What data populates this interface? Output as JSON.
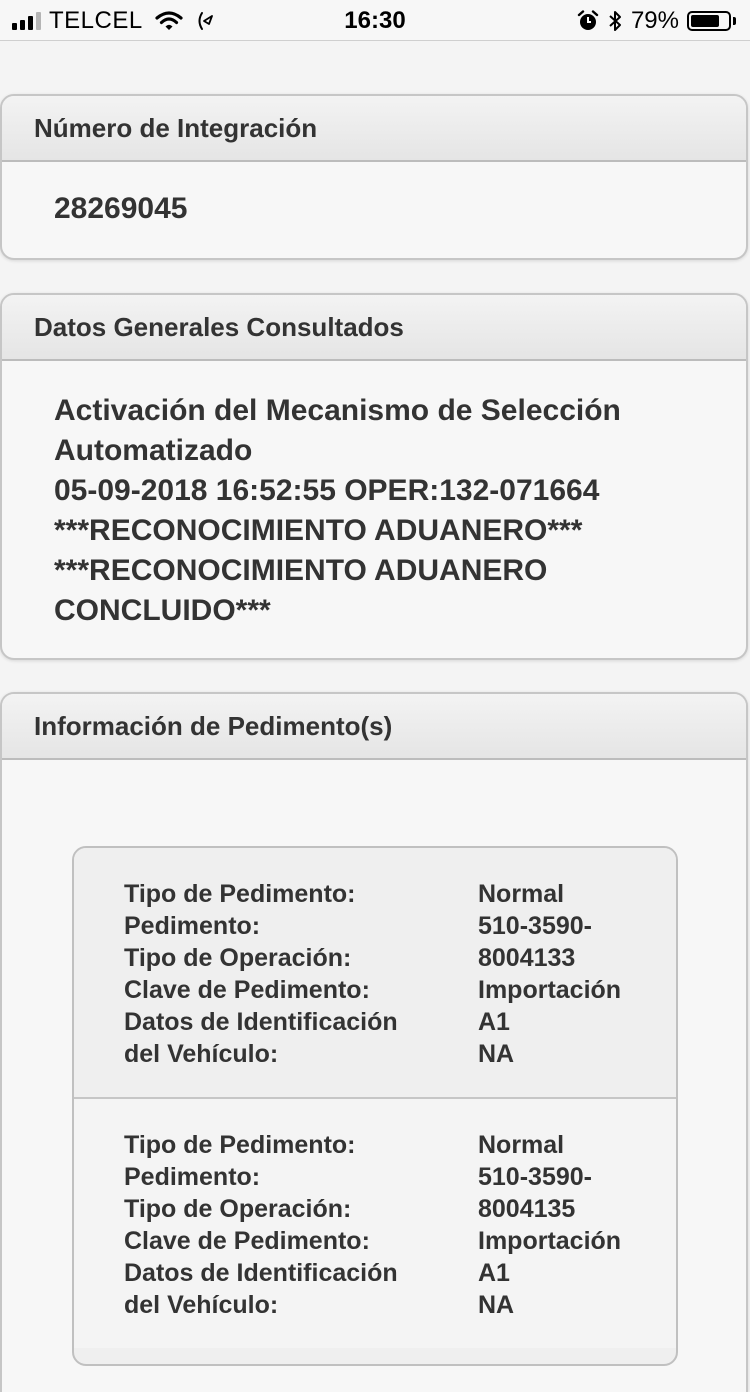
{
  "status_bar": {
    "carrier": "TELCEL",
    "time": "16:30",
    "battery_percent": "79%",
    "battery_level": 0.79,
    "icons": [
      "signal-icon",
      "wifi-icon",
      "location-icon",
      "alarm-icon",
      "bluetooth-icon",
      "battery-icon"
    ]
  },
  "integration": {
    "header": "Número de Integración",
    "number": "28269045"
  },
  "general_data": {
    "header": "Datos Generales Consultados",
    "lines": [
      "Activación del Mecanismo de Selección",
      "Automatizado",
      "05-09-2018 16:52:55 OPER:132-071664",
      "***RECONOCIMIENTO ADUANERO***",
      "***RECONOCIMIENTO ADUANERO",
      "CONCLUIDO***"
    ]
  },
  "pedimentos": {
    "header": "Información de Pedimento(s)",
    "items": [
      {
        "rows": [
          {
            "label": "Tipo de Pedimento:",
            "value": "Normal"
          },
          {
            "label": "Pedimento:",
            "value": "510-3590-"
          },
          {
            "label": "Tipo de Operación:",
            "value": "8004133"
          },
          {
            "label": "Clave de Pedimento:",
            "value": "Importación"
          },
          {
            "label": "Datos de Identificación",
            "value": "A1"
          },
          {
            "label": "del Vehículo:",
            "value": "NA"
          }
        ]
      },
      {
        "rows": [
          {
            "label": "Tipo de Pedimento:",
            "value": "Normal"
          },
          {
            "label": "Pedimento:",
            "value": "510-3590-"
          },
          {
            "label": "Tipo de Operación:",
            "value": "8004135"
          },
          {
            "label": "Clave de Pedimento:",
            "value": "Importación"
          },
          {
            "label": "Datos de Identificación",
            "value": "A1"
          },
          {
            "label": "del Vehículo:",
            "value": "NA"
          }
        ]
      }
    ]
  }
}
